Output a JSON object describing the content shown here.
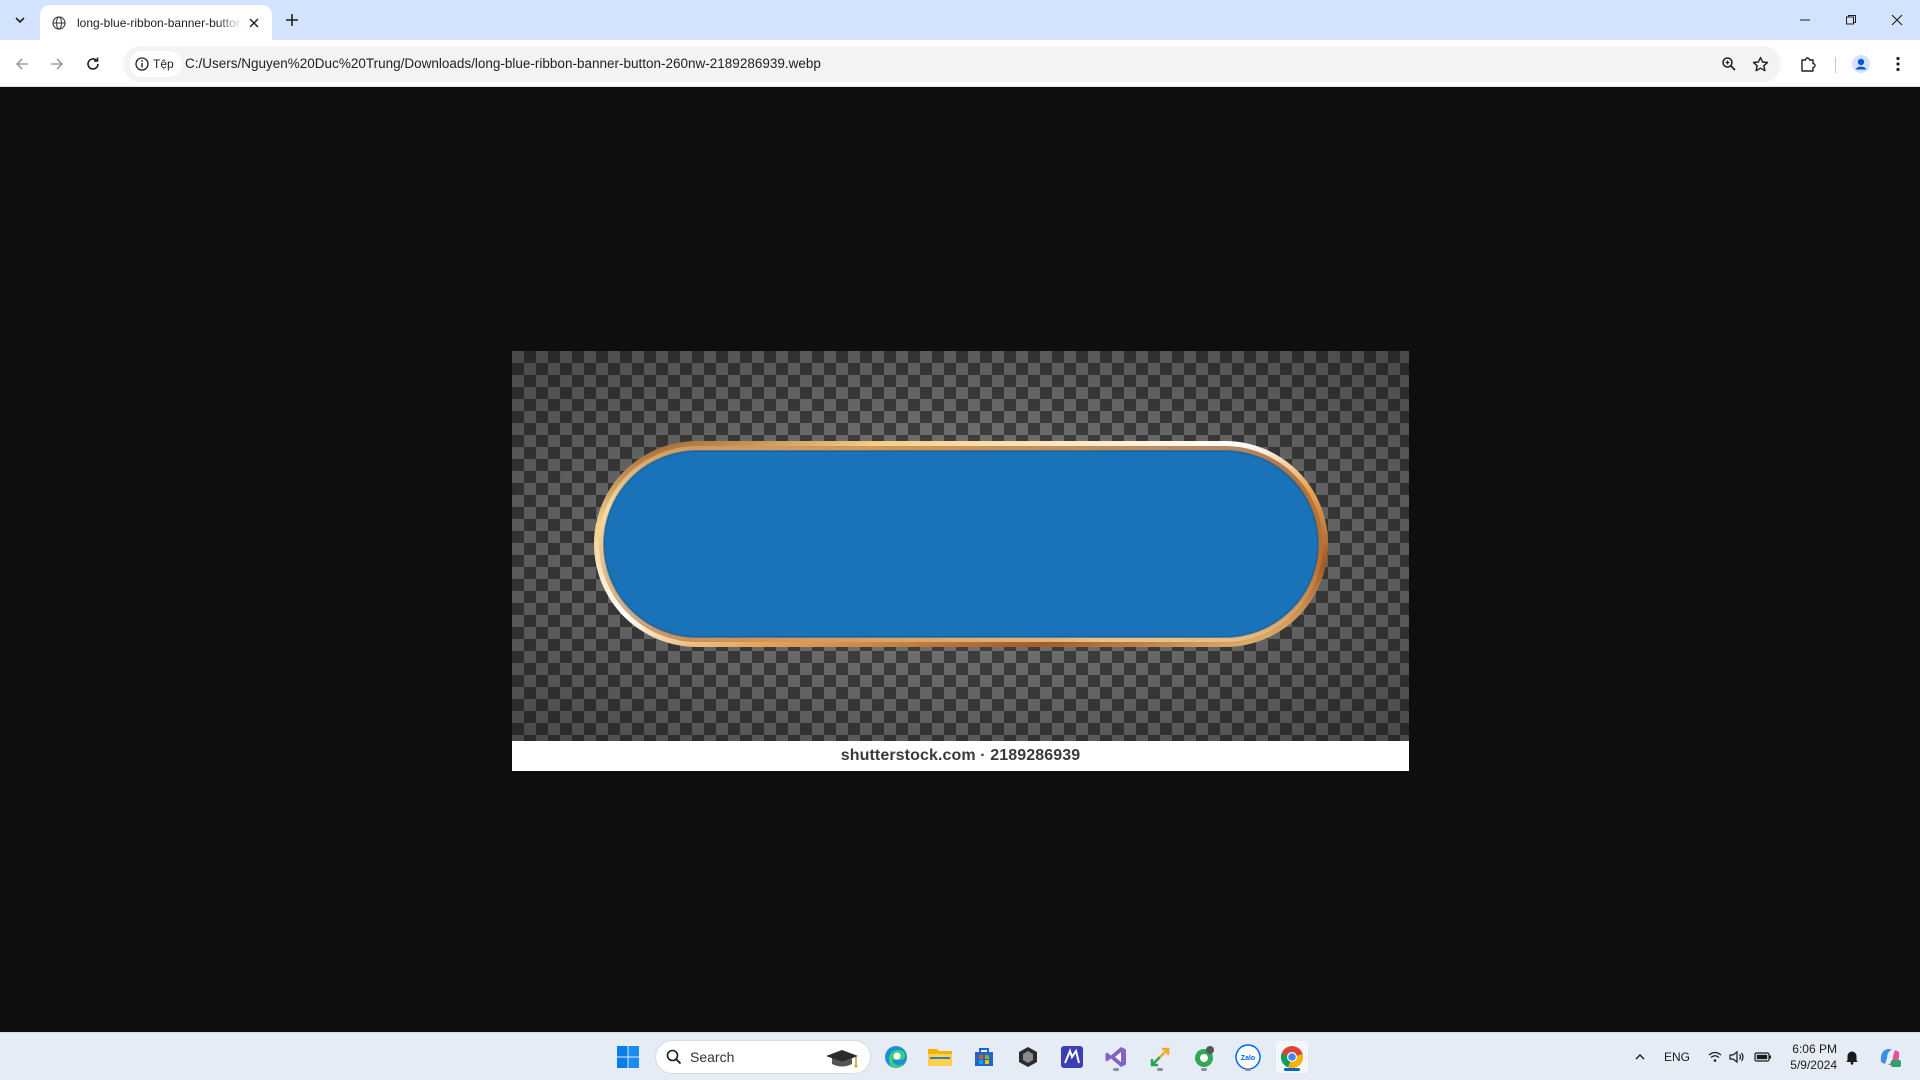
{
  "browser": {
    "tab": {
      "title": "long-blue-ribbon-banner-button-260nw-2189286939.webp"
    },
    "address_bar": {
      "chip_label": "Tệp",
      "url": "C:/Users/Nguyen%20Duc%20Trung/Downloads/long-blue-ribbon-banner-button-260nw-2189286939.webp"
    },
    "window_controls": [
      "minimize",
      "restore",
      "close"
    ]
  },
  "viewer": {
    "watermark": "shutterstock.com · 2189286939",
    "colors": {
      "ribbon_fill": "#1a72b8",
      "ribbon_border": "#c98a3e",
      "background": "#0e0e0e"
    }
  },
  "taskbar": {
    "search_placeholder": "Search",
    "apps": [
      "start-icon",
      "edge-icon",
      "file-explorer-icon",
      "microsoft-store-icon",
      "unity-icon",
      "app-m-icon",
      "visual-studio-icon",
      "app-arrows-icon",
      "app-green-icon",
      "zalo-icon",
      "chrome-icon"
    ],
    "tray": {
      "language": "ENG",
      "time": "6:06 PM",
      "date": "5/9/2024"
    },
    "zalo_label": "Zalo"
  }
}
